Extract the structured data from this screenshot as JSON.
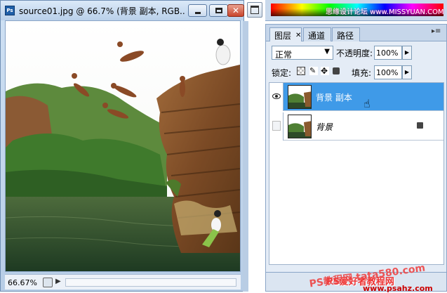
{
  "document": {
    "title": "source01.jpg @ 66.7% (背景 副本, RGB...",
    "zoom": "66.67%"
  },
  "color_panel": {
    "watermark": "思缘设计论坛 www.MISSYUAN.COM"
  },
  "layers_panel": {
    "tabs": [
      {
        "label": "图层",
        "active": true
      },
      {
        "label": "通道",
        "active": false
      },
      {
        "label": "路径",
        "active": false
      }
    ],
    "blend_mode": "正常",
    "opacity_label": "不透明度:",
    "opacity_value": "100%",
    "lock_label": "锁定:",
    "fill_label": "填充:",
    "fill_value": "100%",
    "layers": [
      {
        "name": "背景 副本",
        "visible": true,
        "selected": true,
        "locked": false
      },
      {
        "name": "背景",
        "visible": false,
        "selected": false,
        "locked": true
      }
    ]
  },
  "watermarks": {
    "bottom_line1": "PS爱好者教程网",
    "bottom_line2": "www.psahz.com",
    "diagonal": "PS教程网 tata580.com"
  },
  "colors": {
    "selected_layer": "#3f9ae8",
    "chrome": "#c6d6ea"
  },
  "icons": {
    "ps-file": "ps-file-icon",
    "minimize": "minimize-icon",
    "maximize": "maximize-icon",
    "close": "close-icon",
    "eye": "eye-icon",
    "lock": "lock-icon",
    "pointer": "hand-pointer-icon"
  }
}
